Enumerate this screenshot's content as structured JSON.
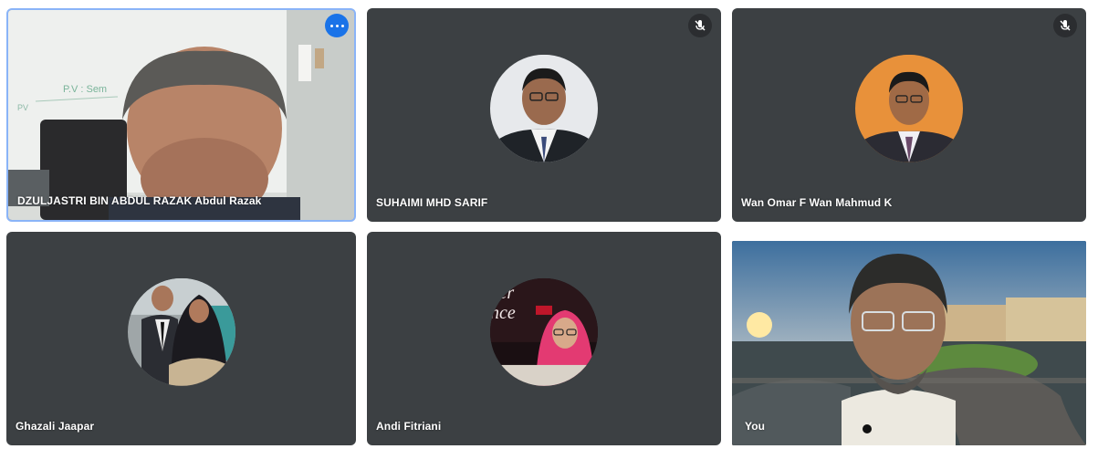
{
  "participants": [
    {
      "name": "DZULJASTRI BIN ABDUL RAZAK Abdul Razak",
      "muted": false,
      "video": true,
      "active": true
    },
    {
      "name": "SUHAIMI MHD SARIF",
      "muted": true,
      "video": false
    },
    {
      "name": "Wan Omar F Wan Mahmud K",
      "muted": true,
      "video": false
    },
    {
      "name": "Ghazali Jaapar",
      "muted": false,
      "video": false
    },
    {
      "name": "Andi Fitriani",
      "muted": false,
      "video": false
    },
    {
      "name": "You",
      "muted": false,
      "video": true,
      "self": true
    }
  ],
  "colors": {
    "tile_bg": "#3c4043",
    "active_border": "#8ab4f8",
    "more_button": "#1a73e8"
  }
}
